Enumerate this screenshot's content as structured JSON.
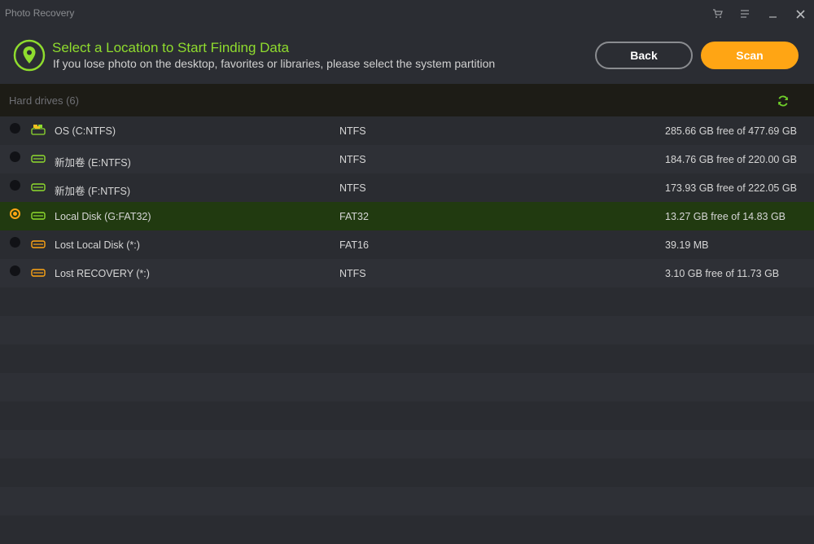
{
  "app": {
    "title": "Photo Recovery"
  },
  "header": {
    "title": "Select a Location to Start Finding Data",
    "subtitle": "If you lose photo on the desktop, favorites or libraries, please select the system partition",
    "back_label": "Back",
    "scan_label": "Scan"
  },
  "section": {
    "label": "Hard drives (6)"
  },
  "colors": {
    "accent_green": "#8fdc2e",
    "accent_orange": "#ffa514",
    "selected_row": "#213a10",
    "section_bar": "#1d1c16"
  },
  "drives": [
    {
      "name": "OS (C:NTFS)",
      "fs": "NTFS",
      "size": "285.66 GB free of 477.69 GB",
      "icon": "system-drive-icon",
      "selected": false
    },
    {
      "name": "新加卷 (E:NTFS)",
      "fs": "NTFS",
      "size": "184.76 GB free of 220.00 GB",
      "icon": "drive-icon",
      "selected": false
    },
    {
      "name": "新加卷 (F:NTFS)",
      "fs": "NTFS",
      "size": "173.93 GB free of 222.05 GB",
      "icon": "drive-icon",
      "selected": false
    },
    {
      "name": "Local Disk (G:FAT32)",
      "fs": "FAT32",
      "size": "13.27 GB free of 14.83 GB",
      "icon": "drive-icon",
      "selected": true
    },
    {
      "name": "Lost Local Disk (*:)",
      "fs": "FAT16",
      "size": "39.19 MB",
      "icon": "lost-drive-icon",
      "selected": false
    },
    {
      "name": "Lost RECOVERY (*:)",
      "fs": "NTFS",
      "size": "3.10 GB free of 11.73 GB",
      "icon": "lost-drive-icon",
      "selected": false
    }
  ]
}
